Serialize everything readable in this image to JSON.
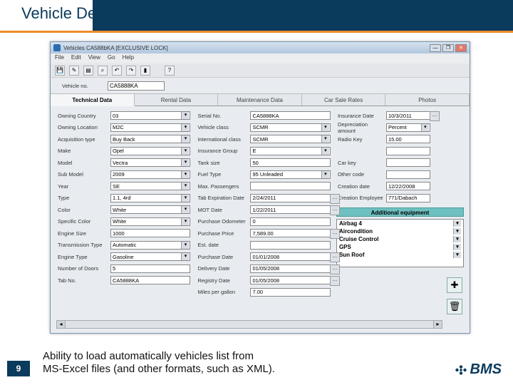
{
  "slide": {
    "title": "Vehicle Details",
    "page": "9",
    "caption_line1": "Ability to load automatically vehicles list from",
    "caption_line2": "MS-Excel files (and other formats, such as XML).",
    "logo_text": "BMS"
  },
  "window": {
    "title": "Vehicles  CA588bKA  [EXCLUSIVE LOCK]",
    "menu": [
      "File",
      "Edit",
      "View",
      "Go",
      "Help"
    ],
    "ctrl_min": "—",
    "ctrl_max": "❐",
    "ctrl_close": "✕",
    "veh_no_label": "Vehicle no.",
    "veh_no_value": "CA5888KA",
    "tabs": [
      "Technical Data",
      "Rental Data",
      "Maintenance Data",
      "Car Sale Rates",
      "Photos"
    ]
  },
  "col1": [
    {
      "l": "Owning Country",
      "v": "03",
      "dd": true
    },
    {
      "l": "Owning Location",
      "v": "M2C",
      "dd": true
    },
    {
      "l": "Acquisition type",
      "v": "Buy Back",
      "dd": true
    },
    {
      "l": "Make",
      "v": "Opel",
      "dd": true
    },
    {
      "l": "Model",
      "v": "Vectra",
      "dd": true
    },
    {
      "l": "Sub Model",
      "v": "2009",
      "dd": true
    },
    {
      "l": "Year",
      "v": "SE",
      "dd": true
    },
    {
      "l": "Type",
      "v": "1.1, 4rd",
      "dd": true
    },
    {
      "l": "Color",
      "v": "White",
      "dd": true
    },
    {
      "l": "Specific Color",
      "v": "White",
      "dd": true
    },
    {
      "l": "Engine Size",
      "v": "1000"
    },
    {
      "l": "Transmission Type",
      "v": "Automatic",
      "dd": true
    },
    {
      "l": "Engine Type",
      "v": "Gasoline",
      "dd": true
    },
    {
      "l": "Number of Doors",
      "v": "5"
    },
    {
      "l": "Tab No.",
      "v": "CA5888KA"
    }
  ],
  "col2": [
    {
      "l": "Serial No.",
      "v": "CA5888KA"
    },
    {
      "l": "Vehicle class",
      "v": "SCMR",
      "dd": true
    },
    {
      "l": "International class",
      "v": "SCMR",
      "dd": true
    },
    {
      "l": "Insurance Group",
      "v": "E",
      "dd": true
    },
    {
      "l": "Tank size",
      "v": "50"
    },
    {
      "l": "Fuel Type",
      "v": "95 Unleaded",
      "dd": true
    },
    {
      "l": "Max. Passengers",
      "v": ""
    },
    {
      "l": "Tab Expiration Date",
      "v": "2/24/2011",
      "btn": true
    },
    {
      "l": "MOT Date",
      "v": "1/22/2011",
      "btn": true
    },
    {
      "l": "Purchase Odometer",
      "v": "0"
    },
    {
      "l": "Purchase Price",
      "v": "7,589.00",
      "btn": true
    },
    {
      "l": "Est. date",
      "v": ""
    },
    {
      "l": "Purchase Date",
      "v": "01/01/2008",
      "btn": true
    },
    {
      "l": "Delivery Date",
      "v": "01/05/2008",
      "btn": true
    },
    {
      "l": "Registry Date",
      "v": "01/05/2008",
      "btn": true
    },
    {
      "l": "Miles per gallon",
      "v": "7.00"
    }
  ],
  "col3": [
    {
      "l": "Insurance Date",
      "v": "10/3/2011",
      "btn": true
    },
    {
      "l": "Depreciation amount",
      "v": "Percent",
      "dd": true
    },
    {
      "l": "Radio Key",
      "v": "15.00"
    },
    {
      "l": "",
      "v": ""
    },
    {
      "l": "Car key",
      "v": ""
    },
    {
      "l": "Other code",
      "v": ""
    },
    {
      "l": "Creation date",
      "v": "12/22/2008"
    },
    {
      "l": "Creation Employee",
      "v": "771/Dabach"
    }
  ],
  "equipment": {
    "header": "Additional equipment",
    "items": [
      "Airbag 4",
      "Aircondition",
      "Cruise Control",
      "GPS",
      "Sun Roof"
    ],
    "add": "✚",
    "del": "🗑"
  }
}
